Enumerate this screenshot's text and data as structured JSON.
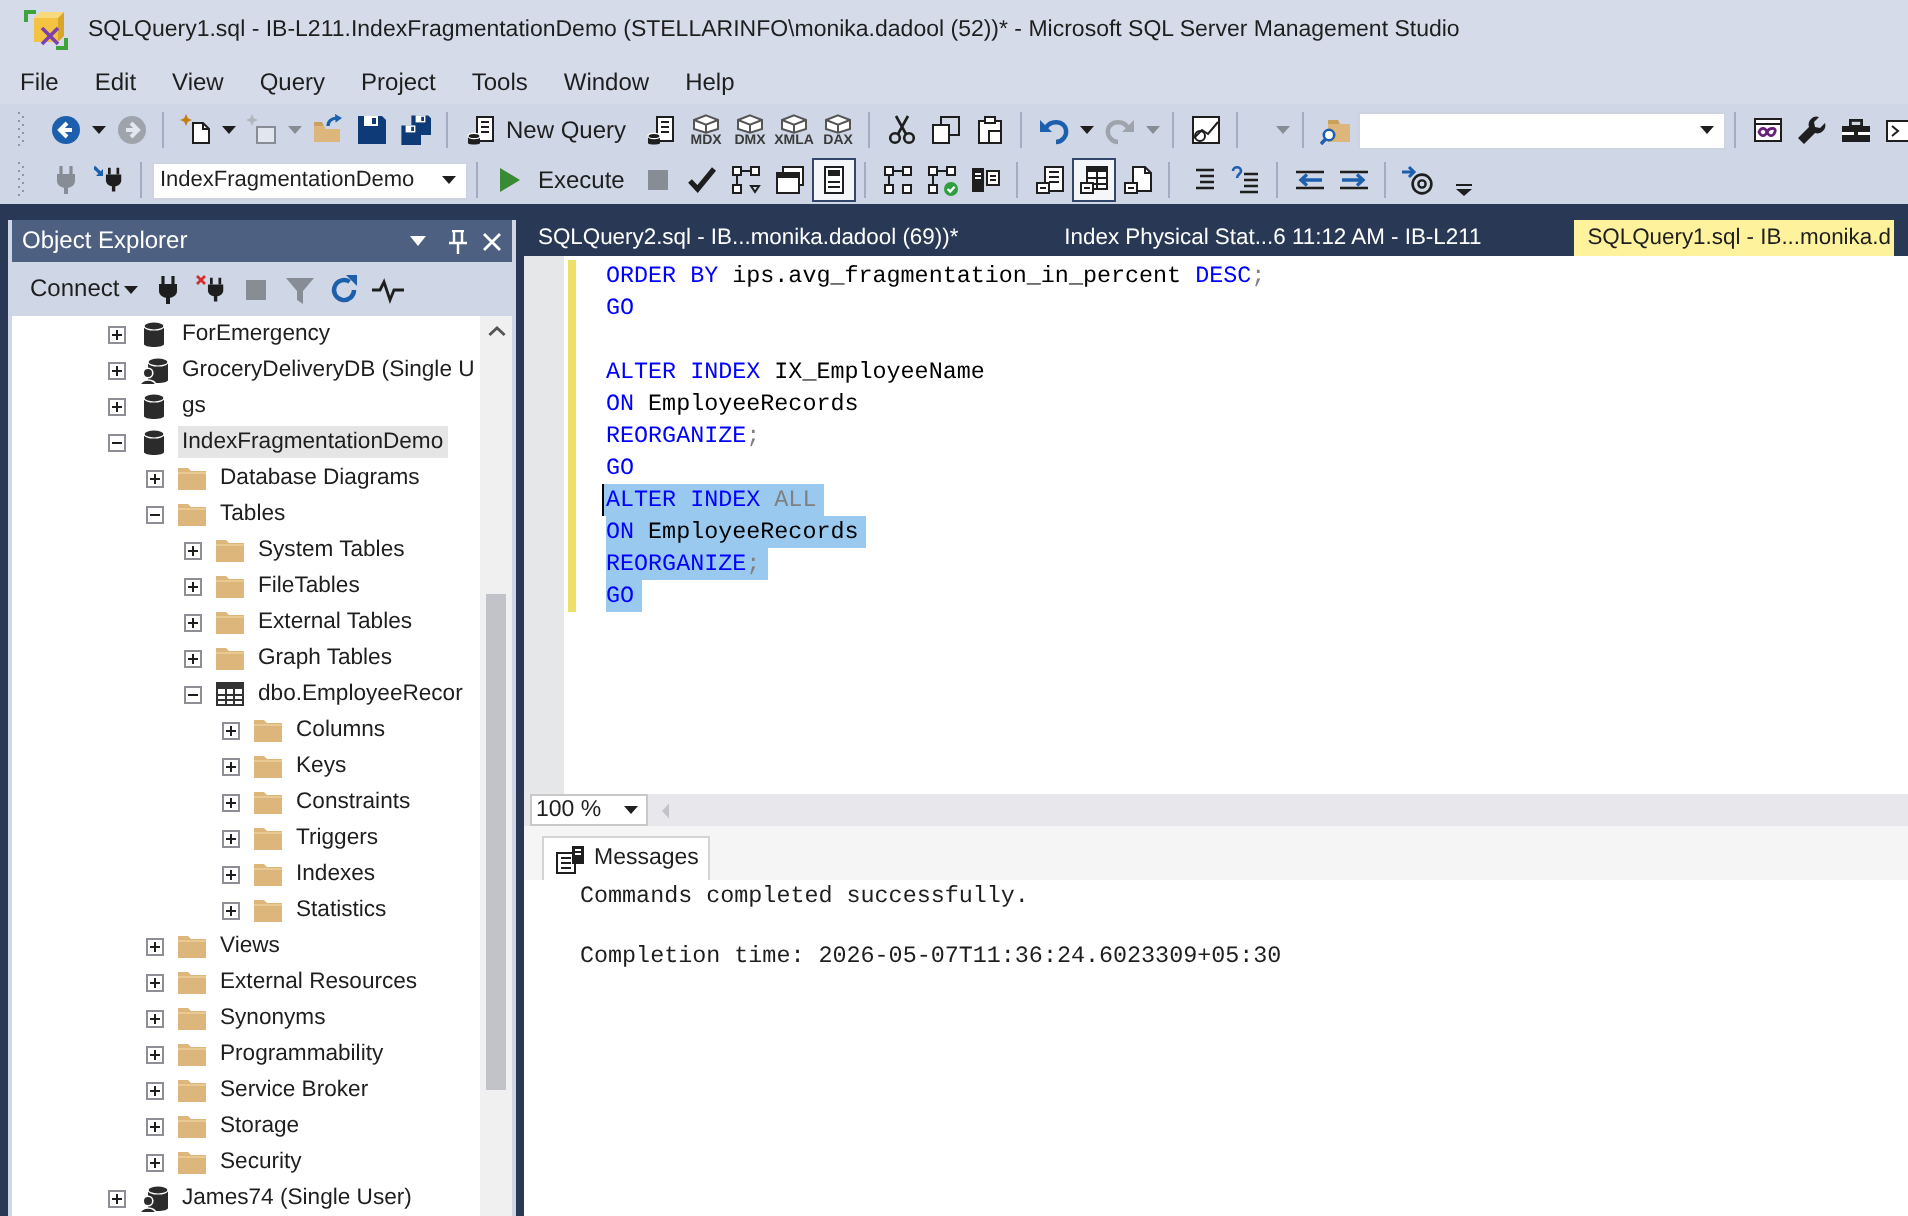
{
  "window": {
    "title": "SQLQuery1.sql - IB-L211.IndexFragmentationDemo (STELLARINFO\\monika.dadool (52))* - Microsoft SQL Server Management Studio"
  },
  "menu": [
    "File",
    "Edit",
    "View",
    "Query",
    "Project",
    "Tools",
    "Window",
    "Help"
  ],
  "standard_toolbar": {
    "groups": [
      [
        {
          "kind": "back",
          "disabled": false
        },
        {
          "kind": "caret",
          "disabled": false
        },
        {
          "kind": "forward",
          "disabled": true
        }
      ],
      [
        {
          "kind": "newproject",
          "disabled": false
        },
        {
          "kind": "caret",
          "disabled": false
        },
        {
          "kind": "additem",
          "disabled": true
        },
        {
          "kind": "caret",
          "disabled": true
        },
        {
          "kind": "open",
          "disabled": false
        },
        {
          "kind": "save",
          "disabled": false
        },
        {
          "kind": "saveall",
          "disabled": false
        }
      ],
      [
        {
          "kind": "newquery",
          "label": "New Query",
          "disabled": false
        },
        {
          "kind": "dbquery",
          "disabled": false
        },
        {
          "kind": "cube",
          "label": "MDX",
          "disabled": false
        },
        {
          "kind": "cube",
          "label": "DMX",
          "disabled": false
        },
        {
          "kind": "cube",
          "label": "XMLA",
          "disabled": false
        },
        {
          "kind": "cube",
          "label": "DAX",
          "disabled": false
        }
      ],
      [
        {
          "kind": "cut",
          "disabled": false
        },
        {
          "kind": "copy",
          "disabled": false
        },
        {
          "kind": "paste",
          "disabled": false
        }
      ],
      [
        {
          "kind": "undo",
          "disabled": false
        },
        {
          "kind": "caret",
          "disabled": false
        },
        {
          "kind": "redo",
          "disabled": true
        },
        {
          "kind": "caret",
          "disabled": true
        }
      ],
      [
        {
          "kind": "activity",
          "disabled": false
        }
      ],
      [
        {
          "kind": "caret",
          "disabled": true
        }
      ],
      [
        {
          "kind": "find",
          "disabled": false
        },
        {
          "kind": "search",
          "disabled": false
        }
      ],
      [
        {
          "kind": "window",
          "disabled": false
        },
        {
          "kind": "wrench",
          "disabled": false
        },
        {
          "kind": "toolbox",
          "disabled": false
        },
        {
          "kind": "terminal",
          "disabled": false
        }
      ]
    ]
  },
  "query_toolbar": {
    "groups": [
      [
        {
          "kind": "connect",
          "disabled": true,
          "checked": false
        },
        {
          "kind": "changeconnection",
          "disabled": false,
          "checked": false
        }
      ],
      [
        {
          "kind": "database",
          "value": "IndexFragmentationDemo",
          "disabled": false,
          "checked": false
        }
      ],
      [
        {
          "kind": "execute",
          "label": "Execute",
          "disabled": false,
          "checked": false
        },
        {
          "kind": "stop",
          "disabled": true,
          "checked": false
        },
        {
          "kind": "parse",
          "disabled": false,
          "checked": false
        },
        {
          "kind": "estimatedplan",
          "disabled": false,
          "checked": false
        },
        {
          "kind": "options",
          "disabled": false,
          "checked": false
        },
        {
          "kind": "intellisense",
          "disabled": false,
          "checked": true
        }
      ],
      [
        {
          "kind": "actualplan",
          "disabled": false,
          "checked": false
        },
        {
          "kind": "livestats",
          "disabled": false,
          "checked": false
        },
        {
          "kind": "clientstats",
          "disabled": false,
          "checked": false
        }
      ],
      [
        {
          "kind": "resultstext",
          "disabled": false,
          "checked": false
        },
        {
          "kind": "resultsgrid",
          "disabled": false,
          "checked": true
        },
        {
          "kind": "resultsfile",
          "disabled": false,
          "checked": false
        }
      ],
      [
        {
          "kind": "comment",
          "disabled": false,
          "checked": false
        },
        {
          "kind": "uncomment",
          "disabled": false,
          "checked": false
        }
      ],
      [
        {
          "kind": "outdent",
          "disabled": false,
          "checked": false
        },
        {
          "kind": "indent",
          "disabled": false,
          "checked": false
        }
      ],
      [
        {
          "kind": "template",
          "disabled": false,
          "checked": false
        }
      ]
    ]
  },
  "object_explorer": {
    "title": "Object Explorer",
    "toolbar": [
      {
        "kind": "connect",
        "label": "Connect",
        "disabled": false
      },
      {
        "kind": "plug",
        "disabled": false
      },
      {
        "kind": "disconnect",
        "disabled": false
      },
      {
        "kind": "stop",
        "disabled": true
      },
      {
        "kind": "filter",
        "disabled": true
      },
      {
        "kind": "refresh",
        "disabled": false
      },
      {
        "kind": "activity",
        "disabled": false
      }
    ],
    "tree": [
      {
        "label": "ForEmergency",
        "kind": "database",
        "expanded": false,
        "selected": false
      },
      {
        "label": "GroceryDeliveryDB (Single U",
        "kind": "singleuser",
        "expanded": false,
        "selected": false
      },
      {
        "label": "gs",
        "kind": "database",
        "expanded": false,
        "selected": false
      },
      {
        "label": "IndexFragmentationDemo",
        "kind": "database",
        "expanded": true,
        "selected": true,
        "children": [
          {
            "label": "Database Diagrams",
            "kind": "folder",
            "expanded": false,
            "selected": false
          },
          {
            "label": "Tables",
            "kind": "folder",
            "expanded": true,
            "selected": false,
            "children": [
              {
                "label": "System Tables",
                "kind": "folder",
                "expanded": false,
                "selected": false
              },
              {
                "label": "FileTables",
                "kind": "folder",
                "expanded": false,
                "selected": false
              },
              {
                "label": "External Tables",
                "kind": "folder",
                "expanded": false,
                "selected": false
              },
              {
                "label": "Graph Tables",
                "kind": "folder",
                "expanded": false,
                "selected": false
              },
              {
                "label": "dbo.EmployeeRecor",
                "kind": "table",
                "expanded": true,
                "selected": false,
                "children": [
                  {
                    "label": "Columns",
                    "kind": "folder",
                    "expanded": false,
                    "selected": false
                  },
                  {
                    "label": "Keys",
                    "kind": "folder",
                    "expanded": false,
                    "selected": false
                  },
                  {
                    "label": "Constraints",
                    "kind": "folder",
                    "expanded": false,
                    "selected": false
                  },
                  {
                    "label": "Triggers",
                    "kind": "folder",
                    "expanded": false,
                    "selected": false
                  },
                  {
                    "label": "Indexes",
                    "kind": "folder",
                    "expanded": false,
                    "selected": false
                  },
                  {
                    "label": "Statistics",
                    "kind": "folder",
                    "expanded": false,
                    "selected": false
                  }
                ]
              }
            ]
          },
          {
            "label": "Views",
            "kind": "folder",
            "expanded": false,
            "selected": false
          },
          {
            "label": "External Resources",
            "kind": "folder",
            "expanded": false,
            "selected": false
          },
          {
            "label": "Synonyms",
            "kind": "folder",
            "expanded": false,
            "selected": false
          },
          {
            "label": "Programmability",
            "kind": "folder",
            "expanded": false,
            "selected": false
          },
          {
            "label": "Service Broker",
            "kind": "folder",
            "expanded": false,
            "selected": false
          },
          {
            "label": "Storage",
            "kind": "folder",
            "expanded": false,
            "selected": false
          },
          {
            "label": "Security",
            "kind": "folder",
            "expanded": false,
            "selected": false
          }
        ]
      },
      {
        "label": "James74 (Single User)",
        "kind": "singleuser",
        "expanded": false,
        "selected": false
      }
    ]
  },
  "editor": {
    "tabs": [
      {
        "label": "SQLQuery2.sql - IB...monika.dadool (69))*",
        "selected": false
      },
      {
        "label": "Index Physical Stat...6 11:12 AM - IB-L211",
        "selected": false
      },
      {
        "label": "SQLQuery1.sql - IB...monika.d",
        "selected": true
      }
    ],
    "lines": [
      {
        "tokens": [
          {
            "kind": "keyword",
            "text": "ORDER BY"
          },
          {
            "kind": "plain",
            "text": " ips.avg_fragmentation_in_percent "
          },
          {
            "kind": "keyword",
            "text": "DESC"
          },
          {
            "kind": "symbol",
            "text": ";"
          }
        ],
        "modified": true,
        "selected": false,
        "cursor": false
      },
      {
        "tokens": [
          {
            "kind": "keyword",
            "text": "GO"
          }
        ],
        "modified": true,
        "selected": false,
        "cursor": false
      },
      {
        "modified": true,
        "selected": false,
        "cursor": false
      },
      {
        "tokens": [
          {
            "kind": "keyword",
            "text": "ALTER INDEX"
          },
          {
            "kind": "plain",
            "text": " IX_EmployeeName"
          }
        ],
        "modified": true,
        "selected": false,
        "cursor": false
      },
      {
        "tokens": [
          {
            "kind": "keyword",
            "text": "ON"
          },
          {
            "kind": "plain",
            "text": " EmployeeRecords"
          }
        ],
        "modified": true,
        "selected": false,
        "cursor": false
      },
      {
        "tokens": [
          {
            "kind": "keyword",
            "text": "REORGANIZE"
          },
          {
            "kind": "symbol",
            "text": ";"
          }
        ],
        "modified": true,
        "selected": false,
        "cursor": false
      },
      {
        "tokens": [
          {
            "kind": "keyword",
            "text": "GO"
          }
        ],
        "modified": true,
        "selected": false,
        "cursor": false
      },
      {
        "tokens": [
          {
            "kind": "keyword",
            "text": "ALTER INDEX"
          },
          {
            "kind": "symbol",
            "text": " ALL"
          }
        ],
        "modified": true,
        "selected": true,
        "cursor": true
      },
      {
        "tokens": [
          {
            "kind": "keyword",
            "text": "ON"
          },
          {
            "kind": "plain",
            "text": " EmployeeRecords"
          }
        ],
        "modified": true,
        "selected": true,
        "cursor": false
      },
      {
        "tokens": [
          {
            "kind": "keyword",
            "text": "REORGANIZE"
          },
          {
            "kind": "symbol",
            "text": ";"
          }
        ],
        "modified": true,
        "selected": true,
        "cursor": false
      },
      {
        "tokens": [
          {
            "kind": "keyword",
            "text": "GO"
          }
        ],
        "modified": true,
        "selected": true,
        "cursor": false
      }
    ],
    "zoom": "100 %"
  },
  "results": {
    "tabs": [
      {
        "label": "Messages",
        "selected": true
      }
    ],
    "messages": [
      "Commands completed successfully.",
      "Completion time: 2026-05-07T11:36:24.6023309+05:30"
    ]
  }
}
